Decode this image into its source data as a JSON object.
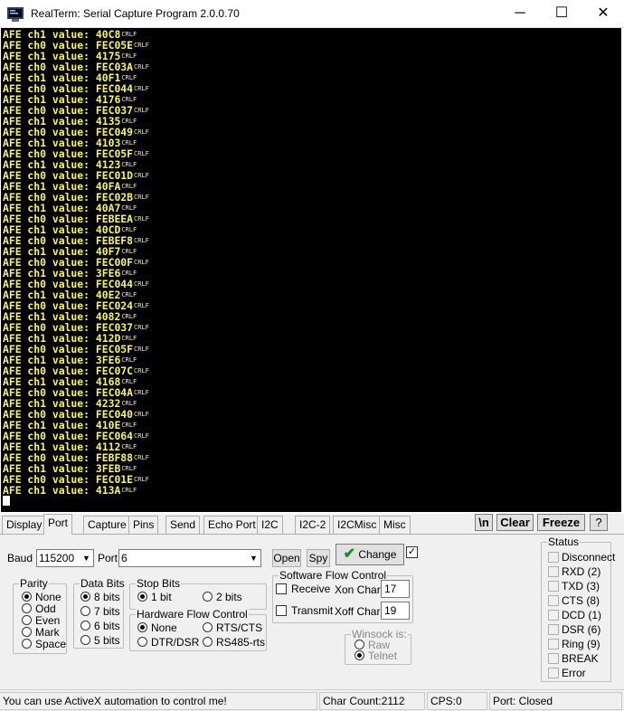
{
  "window": {
    "title": "RealTerm: Serial Capture Program 2.0.0.70",
    "minimize_glyph": "─",
    "maximize_glyph": "☐",
    "close_glyph": "✕"
  },
  "terminal": {
    "crlf_marker": "CRLF",
    "lines": [
      "AFE ch1 value: 40C8",
      "AFE ch0 value: FEC05E",
      "AFE ch1 value: 4175",
      "AFE ch0 value: FEC03A",
      "AFE ch1 value: 40F1",
      "AFE ch0 value: FEC044",
      "AFE ch1 value: 4176",
      "AFE ch0 value: FEC037",
      "AFE ch1 value: 4135",
      "AFE ch0 value: FEC049",
      "AFE ch1 value: 4103",
      "AFE ch0 value: FEC05F",
      "AFE ch1 value: 4123",
      "AFE ch0 value: FEC01D",
      "AFE ch1 value: 40FA",
      "AFE ch0 value: FEC02B",
      "AFE ch1 value: 40A7",
      "AFE ch0 value: FEBEEA",
      "AFE ch1 value: 40CD",
      "AFE ch0 value: FEBEF8",
      "AFE ch1 value: 40F7",
      "AFE ch0 value: FEC00F",
      "AFE ch1 value: 3FE6",
      "AFE ch0 value: FEC044",
      "AFE ch1 value: 40E2",
      "AFE ch0 value: FEC024",
      "AFE ch1 value: 4082",
      "AFE ch0 value: FEC037",
      "AFE ch1 value: 412D",
      "AFE ch0 value: FEC05F",
      "AFE ch1 value: 3FE6",
      "AFE ch0 value: FEC07C",
      "AFE ch1 value: 4168",
      "AFE ch0 value: FEC04A",
      "AFE ch1 value: 4232",
      "AFE ch0 value: FEC040",
      "AFE ch1 value: 410E",
      "AFE ch0 value: FEC064",
      "AFE ch1 value: 4112",
      "AFE ch0 value: FEBF88",
      "AFE ch1 value: 3FEB",
      "AFE ch0 value: FEC01E",
      "AFE ch1 value: 413A"
    ]
  },
  "tabs": [
    "Display",
    "Port",
    "Capture",
    "Pins",
    "Send",
    "Echo Port",
    "I2C",
    "I2C-2",
    "I2CMisc",
    "Misc"
  ],
  "toolbar": {
    "newline_label": "\\n",
    "clear_label": "Clear",
    "freeze_label": "Freeze",
    "help_label": "?"
  },
  "port": {
    "baud_label": "Baud",
    "baud_value": "115200",
    "port_label": "Port",
    "port_value": "6",
    "open_label": "Open",
    "spy_label": "Spy",
    "change_label": "Change",
    "parity": {
      "title": "Parity",
      "options": [
        "None",
        "Odd",
        "Even",
        "Mark",
        "Space"
      ],
      "selected": "None"
    },
    "data_bits": {
      "title": "Data Bits",
      "options": [
        "8 bits",
        "7 bits",
        "6 bits",
        "5 bits"
      ],
      "selected": "8 bits"
    },
    "stop_bits": {
      "title": "Stop Bits",
      "options": [
        "1 bit",
        "2 bits"
      ],
      "selected": "1 bit"
    },
    "hw_flow": {
      "title": "Hardware Flow Control",
      "options": [
        "None",
        "RTS/CTS",
        "DTR/DSR",
        "RS485-rts"
      ],
      "selected": "None"
    },
    "sw_flow": {
      "title": "Software Flow Control",
      "receive_label": "Receive",
      "transmit_label": "Transmit",
      "xon_label": "Xon Char:",
      "xon_value": "17",
      "xoff_label": "Xoff Char:",
      "xoff_value": "19"
    },
    "winsock": {
      "title": "Winsock is:",
      "options": [
        "Raw",
        "Telnet"
      ],
      "selected": "Telnet"
    }
  },
  "status": {
    "title": "Status",
    "items": [
      "Disconnect",
      "RXD (2)",
      "TXD (3)",
      "CTS (8)",
      "DCD (1)",
      "DSR (6)",
      "Ring (9)",
      "BREAK",
      "Error"
    ]
  },
  "statusbar": {
    "message": "You can use ActiveX automation to control me!",
    "char_count": "Char Count:2112",
    "cps": "CPS:0",
    "port_state": "Port: Closed"
  }
}
